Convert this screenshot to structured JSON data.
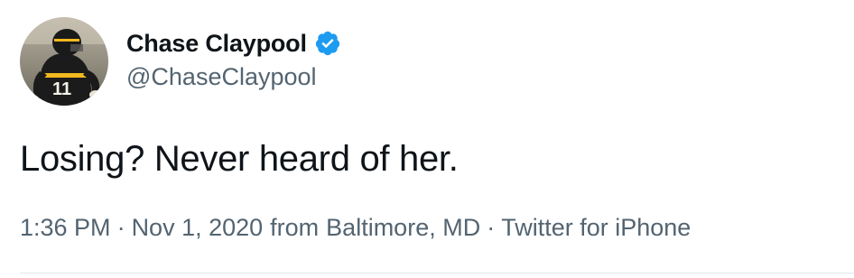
{
  "author": {
    "display_name": "Chase Claypool",
    "handle": "@ChaseClaypool",
    "verified": true,
    "avatar_icon": "player-photo-avatar"
  },
  "tweet": {
    "text": "Losing? Never heard of her."
  },
  "meta": {
    "time": "1:36 PM",
    "date": "Nov 1, 2020",
    "location_prefix": "from",
    "location": "Baltimore, MD",
    "source": "Twitter for iPhone",
    "separator": "·"
  },
  "colors": {
    "verified_blue": "#1d9bf0",
    "text_primary": "#0f1419",
    "text_secondary": "#536471"
  }
}
